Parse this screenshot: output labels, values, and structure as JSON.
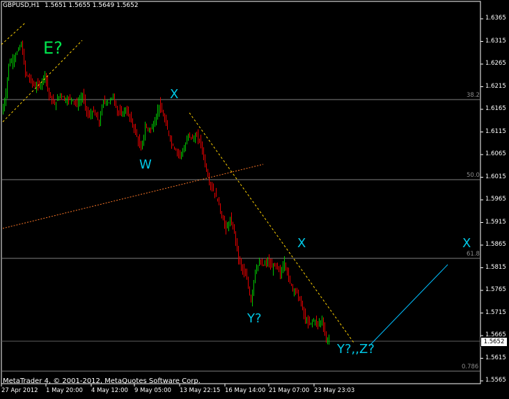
{
  "header": {
    "symbol_period": "GBPUSD,H1",
    "ohlc": "1.5651 1.5655 1.5649 1.5652"
  },
  "copyright": "MetaTrader 4, © 2001-2012, MetaQuotes Software Corp.",
  "current_price": "1.5652",
  "price_axis": [
    "1.6365",
    "1.6315",
    "1.6265",
    "1.6215",
    "1.6165",
    "1.6115",
    "1.6065",
    "1.6015",
    "1.5965",
    "1.5915",
    "1.5865",
    "1.5815",
    "1.5765",
    "1.5715",
    "1.5665",
    "1.5615",
    "1.5565"
  ],
  "time_axis": [
    "27 Apr 2012",
    "1 May 20:00",
    "4 May 12:00",
    "9 May 05:00",
    "13 May 22:15",
    "16 May 14:00",
    "21 May 07:00",
    "23 May 23:03"
  ],
  "fib_levels": [
    "38.2",
    "50.0",
    "61.8",
    "0.786"
  ],
  "wave_labels": {
    "e": "E?",
    "x1": "X",
    "w": "W",
    "y": "Y?",
    "x2": "X",
    "x3": "X",
    "yz": "Y?,,Z?"
  },
  "colors": {
    "background": "#000000",
    "bull_candle": "#00c800",
    "bear_candle": "#e60000",
    "axis_text": "#ffffff",
    "fib_line": "#808080",
    "trendline": "#ffd200",
    "orange_line": "#ff7828",
    "projection_line": "#00bfff",
    "wave_label": "#00c8e6",
    "e_label": "#00e64d"
  }
}
